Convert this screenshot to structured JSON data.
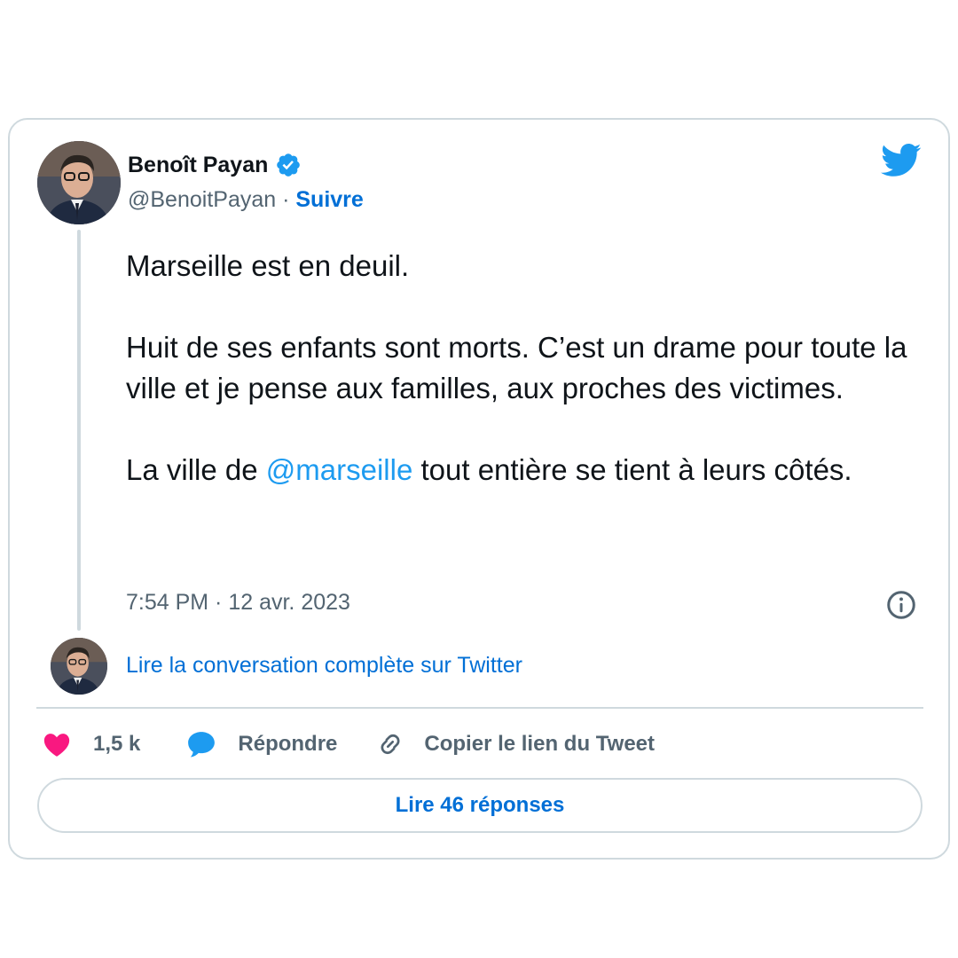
{
  "tweet": {
    "author_name": "Benoît Payan",
    "author_handle": "@BenoitPayan",
    "handle_separator": " · ",
    "follow_label": "Suivre",
    "text_paragraph_1": "Marseille est en deuil.",
    "text_paragraph_2": "Huit de ses enfants sont morts. C’est un drame pour toute la ville et je pense aux familles, aux proches des victimes.",
    "text_paragraph_3_before": "La ville de ",
    "text_paragraph_3_mention": "@marseille",
    "text_paragraph_3_after": " tout entière se tient à leurs côtés.",
    "timestamp": "7:54 PM · 12 avr. 2023"
  },
  "conversation_link": "Lire la conversation complète sur Twitter",
  "actions": {
    "like_count": "1,5 k",
    "reply_label": "Répondre",
    "copy_link_label": "Copier le lien du Tweet"
  },
  "read_replies_label": "Lire 46 réponses",
  "icons": {
    "verified": "verified-badge-icon",
    "brand": "twitter-bird-icon",
    "info": "info-icon",
    "like": "heart-icon",
    "reply": "speech-bubble-icon",
    "copy": "link-icon"
  },
  "colors": {
    "accent_link": "#006fd6",
    "mention": "#1d9bf0",
    "twitter_blue": "#1d9bf0",
    "like_pink": "#f91880",
    "border": "#cfd9de",
    "secondary_text": "#536471"
  }
}
